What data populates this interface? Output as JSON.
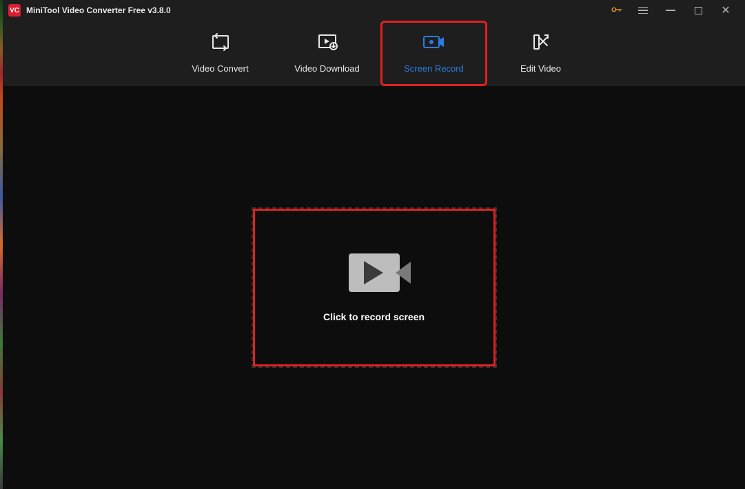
{
  "app": {
    "title": "MiniTool Video Converter Free v3.8.0",
    "logo_text": "VC"
  },
  "title_bar": {
    "upgrade_tooltip": "Upgrade",
    "menu_tooltip": "Menu",
    "minimize_tooltip": "Minimize",
    "maximize_tooltip": "Maximize",
    "close_tooltip": "Close"
  },
  "tabs": [
    {
      "id": "video-convert",
      "label": "Video Convert",
      "icon": "convert-icon",
      "active": false
    },
    {
      "id": "video-download",
      "label": "Video Download",
      "icon": "download-icon",
      "active": false
    },
    {
      "id": "screen-record",
      "label": "Screen Record",
      "icon": "record-icon",
      "active": true,
      "highlighted": true
    },
    {
      "id": "edit-video",
      "label": "Edit Video",
      "icon": "edit-icon",
      "active": false
    }
  ],
  "main": {
    "record_prompt": "Click to record screen"
  },
  "colors": {
    "accent": "#2a7de1",
    "highlight": "#e22020",
    "bg_dark": "#0d0d0d",
    "bg_panel": "#1e1e1e"
  }
}
